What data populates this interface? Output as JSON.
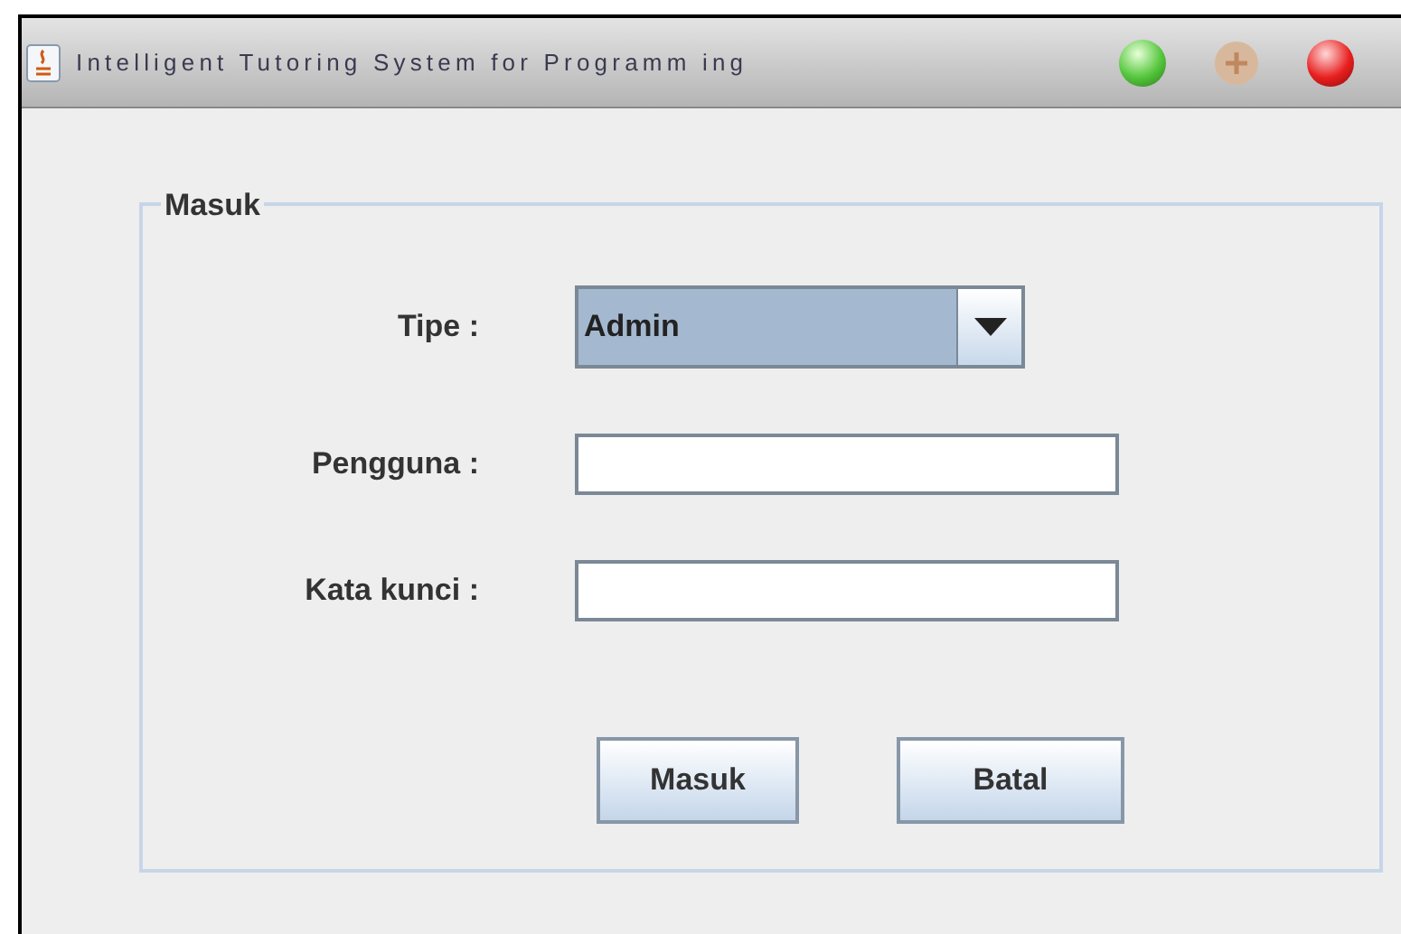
{
  "window": {
    "title": "Intelligent Tutoring System for Programm ing"
  },
  "group": {
    "title": "Masuk"
  },
  "fields": [
    {
      "kind": "combo",
      "label": "Tipe :",
      "value": "Admin"
    },
    {
      "kind": "text",
      "label": "Pengguna :"
    },
    {
      "kind": "text",
      "label": "Kata kunci :"
    }
  ],
  "buttons": [
    "Masuk",
    "Batal"
  ]
}
